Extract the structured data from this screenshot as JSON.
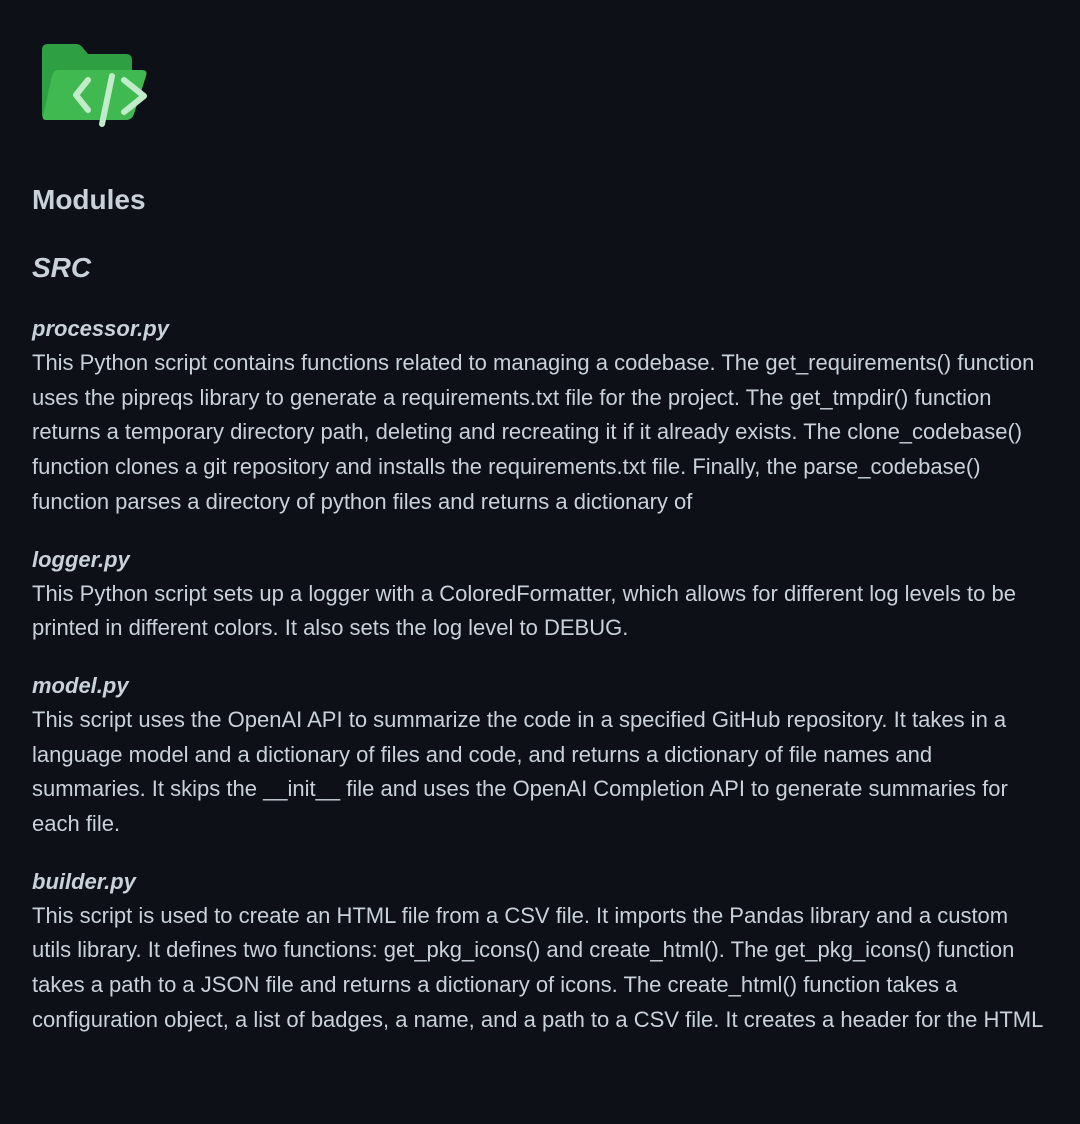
{
  "header": {
    "logo_icon": "folder-code-icon",
    "logo_color": "#2ea043"
  },
  "section_title": "Modules",
  "group_title": "SRC",
  "modules": [
    {
      "name": "processor.py",
      "description": "This Python script contains functions related to managing a codebase. The get_requirements() function uses the pipreqs library to generate a requirements.txt file for the project. The get_tmpdir() function returns a temporary directory path, deleting and recreating it if it already exists. The clone_codebase() function clones a git repository and installs the requirements.txt file. Finally, the parse_codebase() function parses a directory of python files and returns a dictionary of"
    },
    {
      "name": "logger.py",
      "description": "This Python script sets up a logger with a ColoredFormatter, which allows for different log levels to be printed in different colors. It also sets the log level to DEBUG."
    },
    {
      "name": "model.py",
      "description": "This script uses the OpenAI API to summarize the code in a specified GitHub repository. It takes in a language model and a dictionary of files and code, and returns a dictionary of file names and summaries. It skips the __init__ file and uses the OpenAI Completion API to generate summaries for each file."
    },
    {
      "name": "builder.py",
      "description": "This script is used to create an HTML file from a CSV file. It imports the Pandas library and a custom utils library. It defines two functions: get_pkg_icons() and create_html(). The get_pkg_icons() function takes a path to a JSON file and returns a dictionary of icons. The create_html() function takes a configuration object, a list of badges, a name, and a path to a CSV file. It creates a header for the HTML"
    }
  ]
}
